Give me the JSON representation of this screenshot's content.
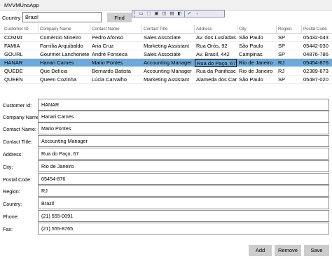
{
  "window": {
    "title": "MVVMUnoApp"
  },
  "search": {
    "label": "Country",
    "value": "Brazil",
    "find_label": "Find"
  },
  "floating_toolbar": {
    "icons": [
      "pointer-icon",
      "select-element-icon",
      "layout-adorner-icon",
      "track-focus-icon",
      "display-layout-icon",
      "toggle-theme-icon",
      "hot-reload-icon"
    ]
  },
  "grid": {
    "columns": [
      "Customer ID",
      "Company Name",
      "Contact Name",
      "Contact Title",
      "Address",
      "City",
      "Region",
      "Postal Code"
    ],
    "rows": [
      [
        "COMMI",
        "Comércio Mineiro",
        "Pedro Afonso",
        "Sales Associate",
        "Av. dos Lusíadas",
        "São Paulo",
        "SP",
        "05432-043"
      ],
      [
        "FAMIA",
        "Familia Arquibaldo",
        "Aria Cruz",
        "Marketing Assistant",
        "Rua Orós, 92",
        "São Paulo",
        "SP",
        "05442-030"
      ],
      [
        "GOURL",
        "Gourmet Lanchonete",
        "André Fonseca",
        "Sales Associate",
        "Av. Brasil, 442",
        "Campinas",
        "SP",
        "04876-786"
      ],
      [
        "HANAR",
        "Hanari Carnes",
        "Mario Pontes",
        "Accounting Manager",
        "Rua do Paço, 67",
        "Rio de Janeiro",
        "RJ",
        "05454-876"
      ],
      [
        "QUEDE",
        "Que Delícia",
        "Bernardo Batista",
        "Accounting Manager",
        "Rua da Panificac",
        "Rio de Janeiro",
        "RJ",
        "02389-673"
      ],
      [
        "QUEEN",
        "Queen Cozinha",
        "Lúcia Carvalho",
        "Marketing Assistant",
        "Alameda dos Car",
        "São Paulo",
        "SP",
        "05487-020"
      ]
    ],
    "selected_row": 3
  },
  "form": {
    "fields": [
      {
        "label": "Customer Id:",
        "value": "HANAR"
      },
      {
        "label": "Company Name:",
        "value": "Hanari Carnes"
      },
      {
        "label": "Contact Name:",
        "value": "Mario Pontes"
      },
      {
        "label": "Contact Title:",
        "value": "Accounting Manager"
      },
      {
        "label": "Address:",
        "value": "Rua do Paço, 67"
      },
      {
        "label": "City:",
        "value": "Rio de Janeiro"
      },
      {
        "label": "Postal Code:",
        "value": "05454-876"
      },
      {
        "label": "Region:",
        "value": "RJ"
      },
      {
        "label": "Country:",
        "value": "Brazil"
      },
      {
        "label": "Phone:",
        "value": "(21) 555-0091"
      },
      {
        "label": "Fax:",
        "value": "(21) 555-8765"
      }
    ]
  },
  "actions": {
    "add": "Add",
    "remove": "Remove",
    "save": "Save"
  }
}
